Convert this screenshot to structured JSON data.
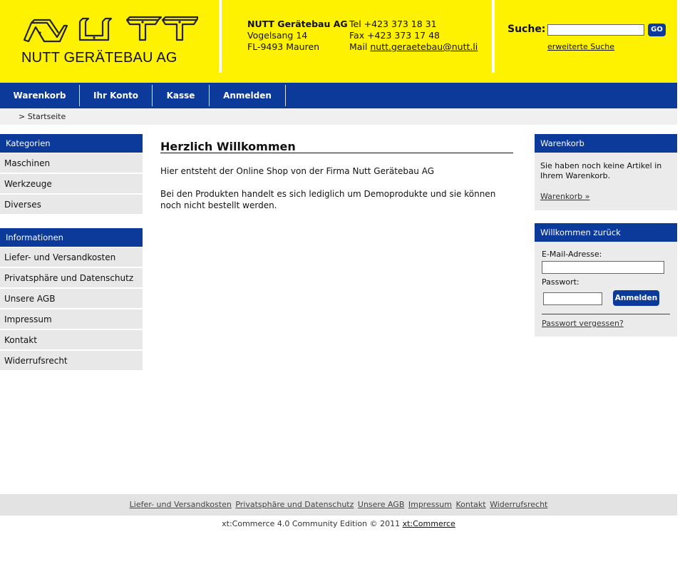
{
  "header": {
    "logo_text": "NUTT GERÄTEBAU AG",
    "company": {
      "name": "NUTT Gerätebau AG",
      "street": "Vogelsang 14",
      "city": "FL-9493 Mauren"
    },
    "contact": {
      "tel": "Tel +423 373 18 31",
      "fax": "Fax +423 373 17 48",
      "mail_label": "Mail ",
      "mail": "nutt.geraetebau@nutt.li"
    },
    "search": {
      "label": "Suche:",
      "value": "",
      "go_label": "GO",
      "advanced": "erweiterte Suche"
    }
  },
  "nav": {
    "items": [
      "Warenkorb",
      "Ihr Konto",
      "Kasse",
      "Anmelden"
    ]
  },
  "breadcrumb": "> Startseite",
  "categories": {
    "title": "Kategorien",
    "items": [
      "Maschinen",
      "Werkzeuge",
      "Diverses"
    ]
  },
  "information": {
    "title": "Informationen",
    "items": [
      "Liefer- und Versandkosten",
      "Privatsphäre und Datenschutz",
      "Unsere AGB",
      "Impressum",
      "Kontakt",
      "Widerrufsrecht"
    ]
  },
  "main": {
    "title": "Herzlich Willkommen",
    "p1": "Hier entsteht der Online Shop von der Firma Nutt Gerätebau AG",
    "p2": "Bei den Produkten handelt es sich lediglich um Demoprodukte und sie können noch nicht bestellt werden."
  },
  "cart_box": {
    "title": "Warenkorb",
    "text": "Sie haben noch keine Artikel in Ihrem Warenkorb.",
    "link": "Warenkorb »"
  },
  "login_box": {
    "title": "Willkommen zurück",
    "email_label": "E-Mail-Adresse:",
    "email_value": "",
    "password_label": "Passwort:",
    "password_value": "",
    "button": "Anmelden",
    "forgot": "Passwort vergessen?"
  },
  "footer": {
    "links": [
      "Liefer- und Versandkosten",
      "Privatsphäre und Datenschutz",
      "Unsere AGB",
      "Impressum",
      "Kontakt",
      "Widerrufsrecht"
    ],
    "copyright_text": "xt:Commerce 4.0 Community Edition © 2011 ",
    "copyright_link": "xt:Commerce"
  },
  "colors": {
    "header_yellow": "#fff200",
    "brand_blue": "#0b3a9a"
  }
}
